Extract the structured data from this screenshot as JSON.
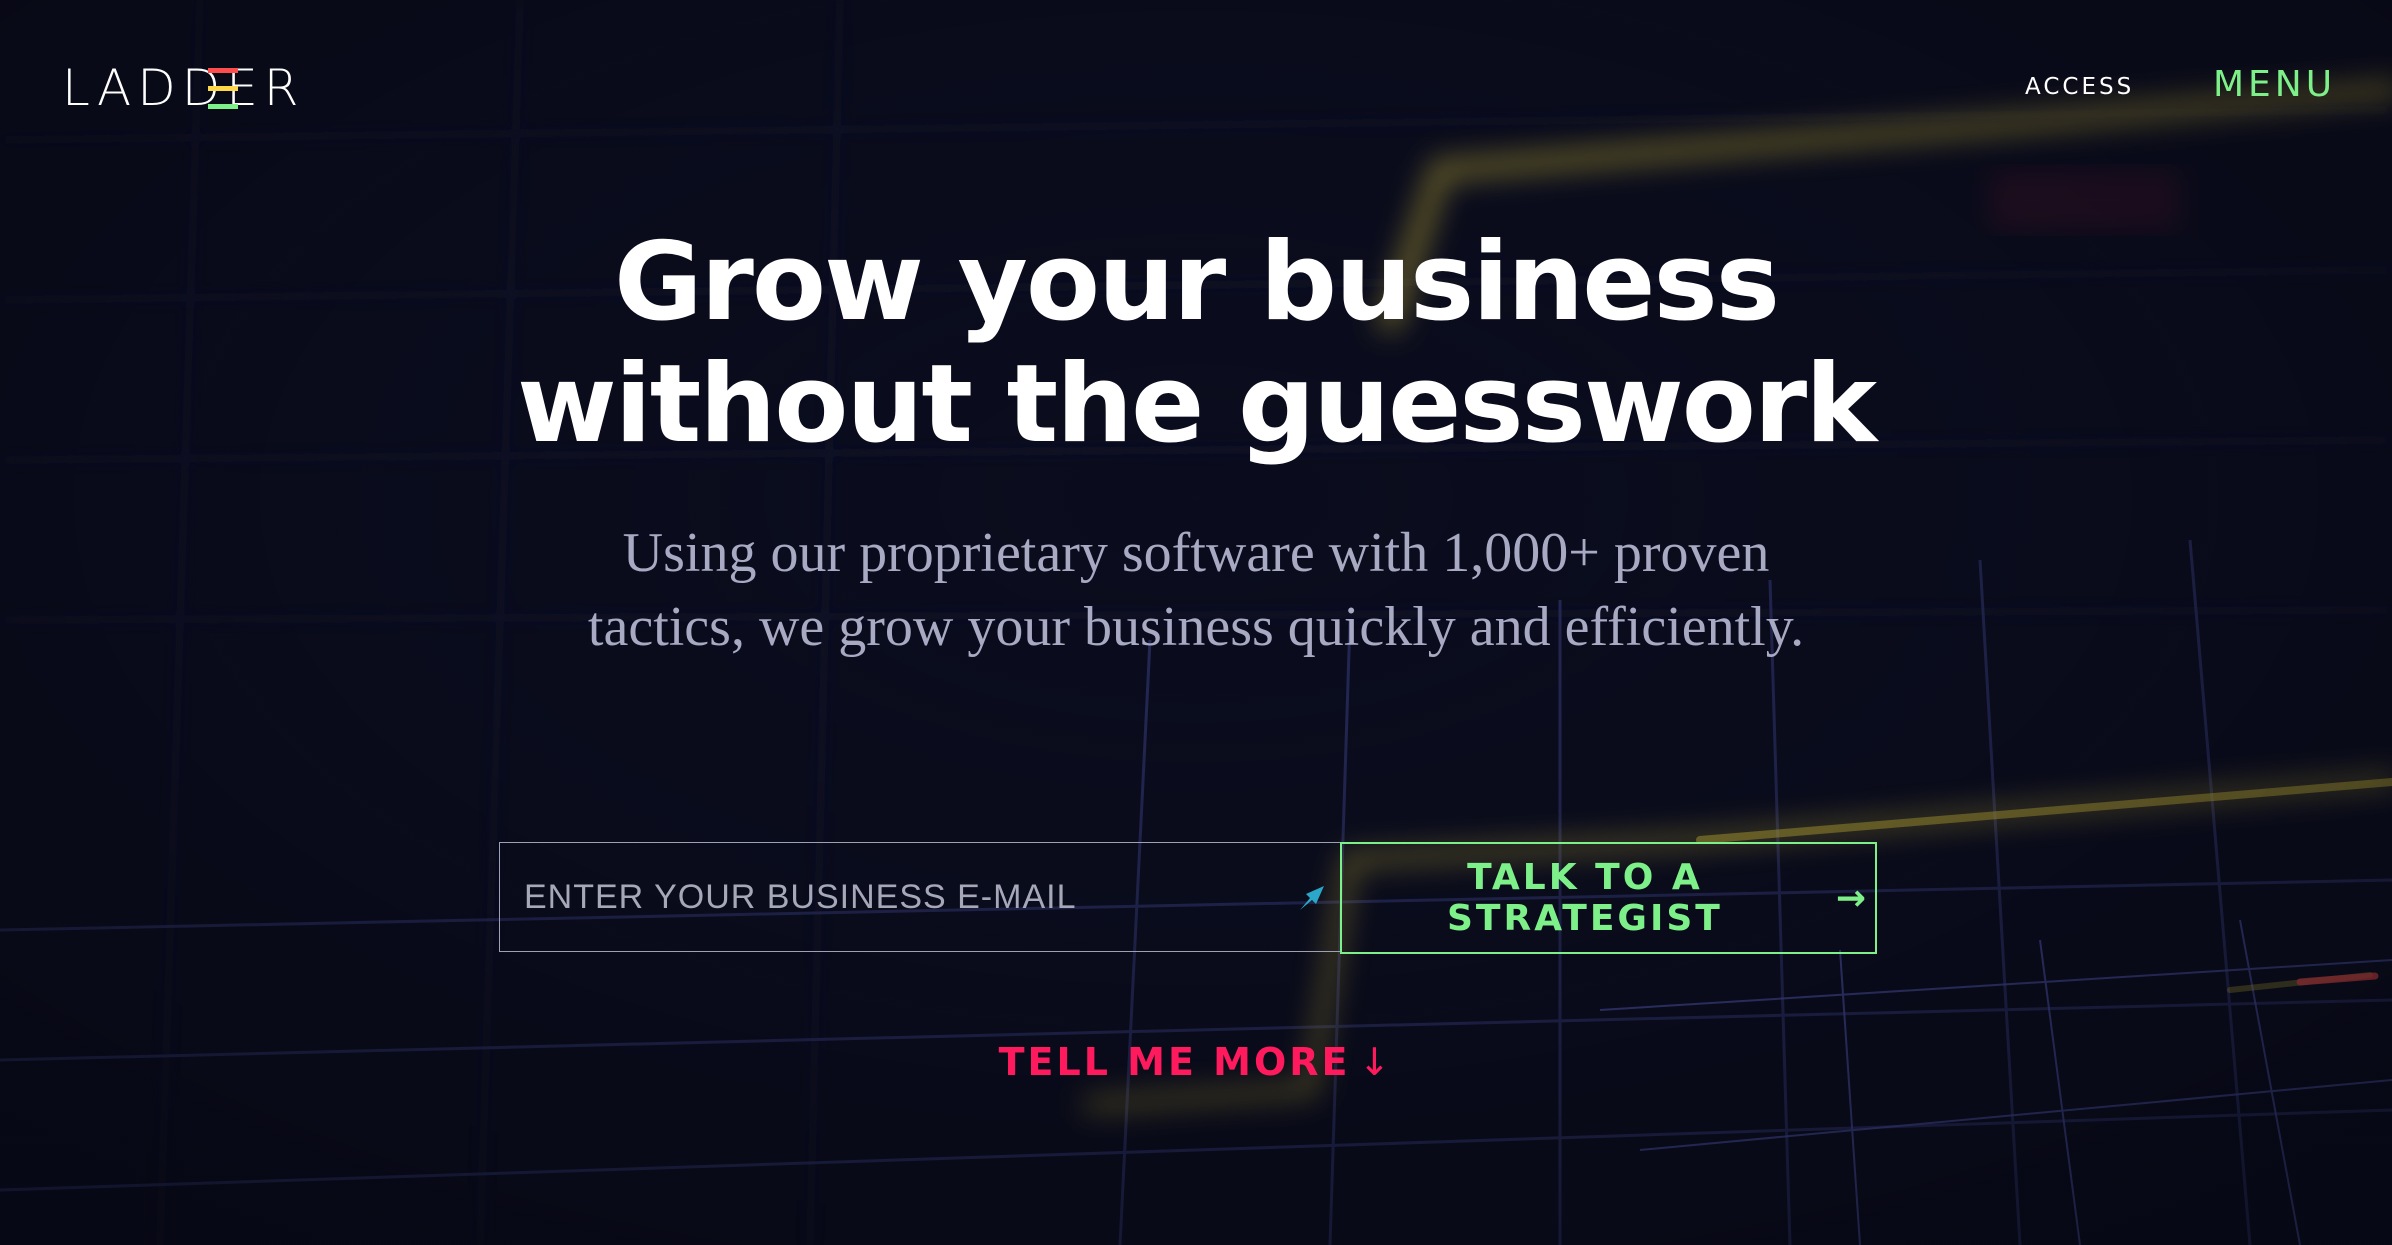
{
  "brand": {
    "logo_text": "LADDER",
    "logo_bar_colors": [
      "#ff4d4d",
      "#ffd84a",
      "#7ef08a"
    ]
  },
  "nav": {
    "access_label": "ACCESS",
    "menu_label": "MENU"
  },
  "hero": {
    "headline_line1": "Grow your business",
    "headline_line2": "without the guesswork",
    "subhead_line1": "Using our proprietary software with 1,000+ proven",
    "subhead_line2": "tactics, we grow your business quickly and efficiently."
  },
  "form": {
    "email_placeholder": "ENTER YOUR BUSINESS E-MAIL",
    "email_value": "",
    "field_icon": "autofill-icon",
    "submit_label": "TALK TO A STRATEGIST",
    "submit_arrow": "→"
  },
  "cta": {
    "tell_more_label": "TELL ME MORE",
    "tell_more_arrow": "↓"
  },
  "colors": {
    "background": "#0b0d1e",
    "accent_green": "#7ef08a",
    "accent_pink": "#ff1a5e",
    "chart_yellow": "#d9c33a",
    "grid": "#3a3f7a"
  }
}
